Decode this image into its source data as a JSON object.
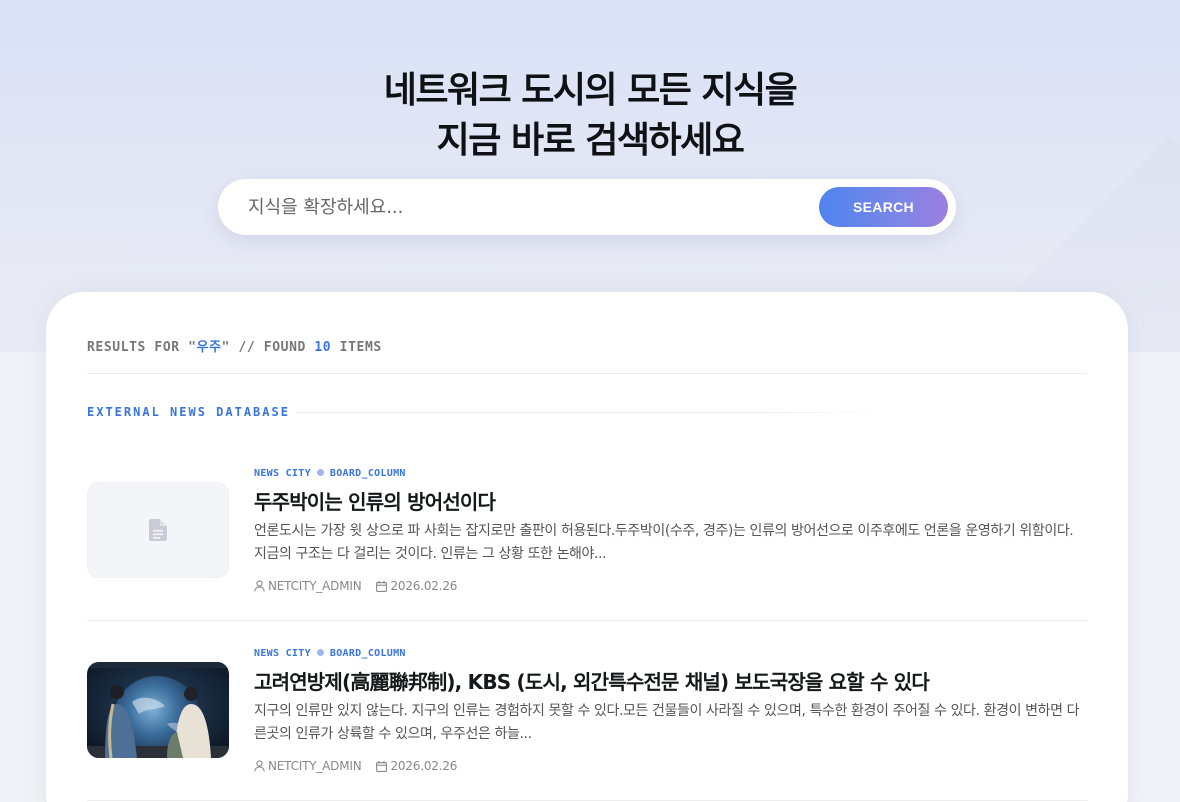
{
  "hero": {
    "title_line1": "네트워크 도시의 모든 지식을",
    "title_line2": "지금 바로 검색하세요"
  },
  "search": {
    "placeholder": "지식을 확장하세요...",
    "button_label": "SEARCH"
  },
  "results": {
    "prefix": "RESULTS FOR \"",
    "query": "우주",
    "middle": "\" // FOUND ",
    "count": "10",
    "suffix": " ITEMS"
  },
  "section": {
    "label": "EXTERNAL NEWS DATABASE"
  },
  "items": [
    {
      "tag1": "NEWS CITY",
      "tag2": "BOARD_COLUMN",
      "title": "두주박이는 인류의 방어선이다",
      "desc": "언론도시는 가장 윗 상으로 파 사회는 잡지로만 출판이 허용된다.두주박이(수주, 경주)는 인류의 방어선으로 이주후에도 언론을 운영하기 위함이다. 지금의 구조는 다 걸리는 것이다. 인류는 그 상황 또한 논해야...",
      "author": "NETCITY_ADMIN",
      "date": "2026.02.26",
      "thumb_icon": "document-icon"
    },
    {
      "tag1": "NEWS CITY",
      "tag2": "BOARD_COLUMN",
      "title": "고려연방제(高麗聯邦制), KBS (도시, 외간특수전문 채널) 보도국장을 요할 수 있다",
      "desc": "지구의 인류만 있지 않는다. 지구의 인류는 경험하지 못할 수 있다.모든 건물들이 사라질 수 있으며, 특수한 환경이 주어질 수 있다. 환경이  변하면 다른곳의 인류가 상륙할 수 있으며, 우주선은 하늘...",
      "author": "NETCITY_ADMIN",
      "date": "2026.02.26",
      "thumb_icon": "earth-view-image"
    }
  ],
  "colors": {
    "accent": "#3a74e0",
    "button_gradient_start": "#4f84ef",
    "button_gradient_end": "#9b7fe0"
  }
}
